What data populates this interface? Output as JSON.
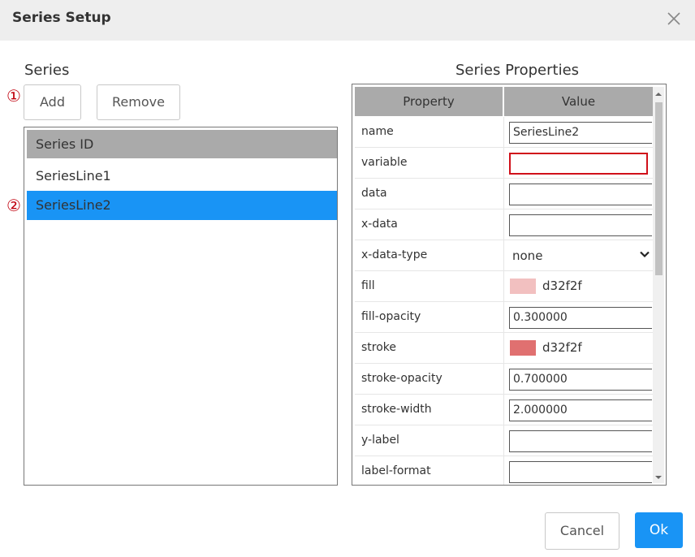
{
  "dialog": {
    "title": "Series Setup"
  },
  "series_panel": {
    "label": "Series",
    "add_label": "Add",
    "remove_label": "Remove",
    "marker_add": "①",
    "marker_selected": "②",
    "list_header": "Series ID",
    "items": [
      {
        "label": "SeriesLine1",
        "selected": false
      },
      {
        "label": "SeriesLine2",
        "selected": true
      }
    ]
  },
  "properties_panel": {
    "label": "Series Properties",
    "col_property": "Property",
    "col_value": "Value",
    "rows": [
      {
        "name": "name",
        "type": "input",
        "value": "SeriesLine2"
      },
      {
        "name": "variable",
        "type": "input",
        "value": "",
        "error": true
      },
      {
        "name": "data",
        "type": "input",
        "value": ""
      },
      {
        "name": "x-data",
        "type": "input",
        "value": ""
      },
      {
        "name": "x-data-type",
        "type": "select",
        "value": "none"
      },
      {
        "name": "fill",
        "type": "color",
        "value": "d32f2f",
        "swatch": "#f2c0c0"
      },
      {
        "name": "fill-opacity",
        "type": "input",
        "value": "0.300000"
      },
      {
        "name": "stroke",
        "type": "color",
        "value": "d32f2f",
        "swatch": "#e07070"
      },
      {
        "name": "stroke-opacity",
        "type": "input",
        "value": "0.700000"
      },
      {
        "name": "stroke-width",
        "type": "input",
        "value": "2.000000"
      },
      {
        "name": "y-label",
        "type": "input",
        "value": ""
      },
      {
        "name": "label-format",
        "type": "input",
        "value": ""
      }
    ]
  },
  "footer": {
    "cancel_label": "Cancel",
    "ok_label": "Ok"
  },
  "colors": {
    "accent": "#1994f5",
    "header": "#aaaaaa",
    "error": "#d0101a",
    "marker": "#c0000d"
  },
  "icons": {
    "close": "close-icon",
    "dropdown": "chevron-down-icon"
  }
}
